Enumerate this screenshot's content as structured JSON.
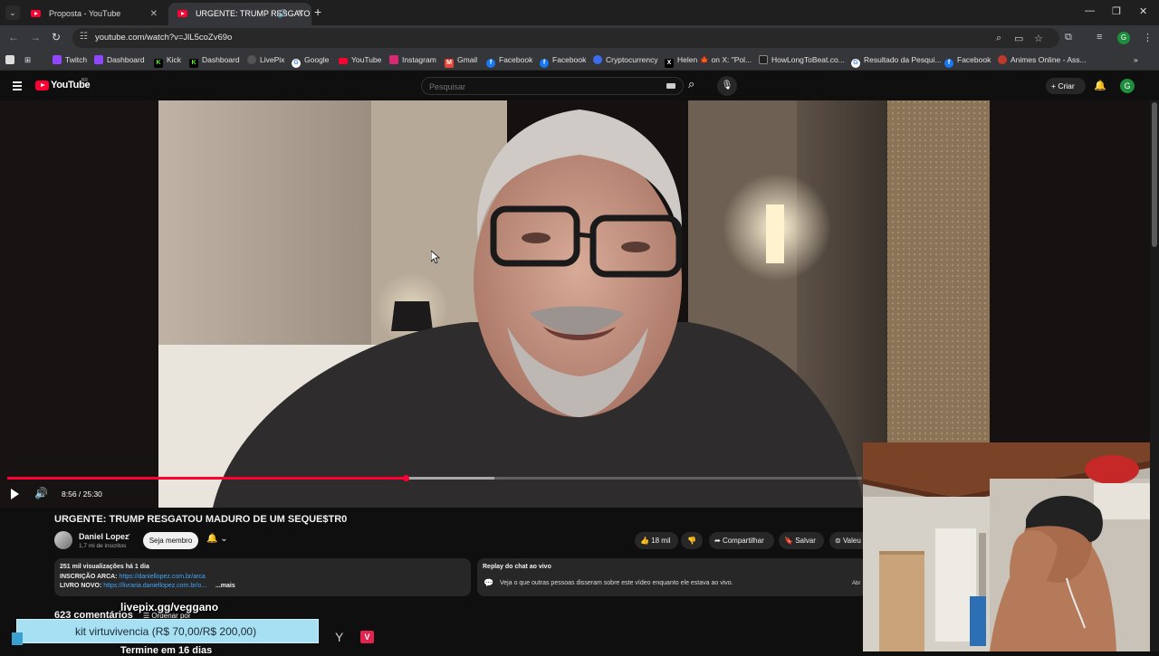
{
  "browser": {
    "tabs": [
      {
        "title": "Proposta - YouTube",
        "active": false
      },
      {
        "title": "URGENTE: TRUMP RESGATO",
        "active": true
      }
    ],
    "new_tab_label": "+",
    "url": "youtube.com/watch?v=JlL5coZv69o",
    "profile_initial": "G",
    "bookmarks": [
      {
        "label": "Twitch",
        "icon": "twitch-icon",
        "color": "#9146ff"
      },
      {
        "label": "Dashboard",
        "icon": "twitch-icon",
        "color": "#9146ff"
      },
      {
        "label": "Kick",
        "icon": "kick-icon",
        "color": "#53fc18"
      },
      {
        "label": "Dashboard",
        "icon": "kick-icon",
        "color": "#53fc18"
      },
      {
        "label": "LivePix",
        "icon": "livepix-icon",
        "color": "#8a8a8a"
      },
      {
        "label": "Google",
        "icon": "google-icon",
        "color": "#ffffff"
      },
      {
        "label": "YouTube",
        "icon": "youtube-icon",
        "color": "#ff0033"
      },
      {
        "label": "Instagram",
        "icon": "instagram-icon",
        "color": "#d62976"
      },
      {
        "label": "Gmail",
        "icon": "gmail-icon",
        "color": "#ea4335"
      },
      {
        "label": "Facebook",
        "icon": "facebook-icon",
        "color": "#1877f2"
      },
      {
        "label": "Facebook",
        "icon": "facebook-icon",
        "color": "#1877f2"
      },
      {
        "label": "Cryptocurrency",
        "icon": "crypto-icon",
        "color": "#3c6cf0"
      },
      {
        "label": "Helen 🍁 on X: \"Pol...",
        "icon": "x-icon",
        "color": "#000000"
      },
      {
        "label": "HowLongToBeat.co...",
        "icon": "hltb-icon",
        "color": "#222222"
      },
      {
        "label": "Resultado da Pesqui...",
        "icon": "google-icon",
        "color": "#ffffff"
      },
      {
        "label": "Facebook",
        "icon": "facebook-icon",
        "color": "#1877f2"
      },
      {
        "label": "Animes Online - Ass...",
        "icon": "anime-icon",
        "color": "#c0392b"
      }
    ]
  },
  "youtube": {
    "logo_text": "YouTube",
    "country_code": "BR",
    "search_placeholder": "Pesquisar",
    "create_label": "Criar",
    "avatar_initial": "G"
  },
  "player": {
    "current_time": "8:56",
    "duration": "25:30",
    "time_display": "8:56 / 25:30",
    "played_fraction": 0.466,
    "buffered_fraction": 0.57
  },
  "video": {
    "title": "URGENTE: TRUMP RESGATOU MADURO DE UM SEQUE$TR0",
    "channel": "Daniel Lopez",
    "subscribers": "1,7 mi de inscritos",
    "join_label": "Seja membro",
    "likes": "18 mil",
    "share_label": "Compartilhar",
    "save_label": "Salvar",
    "thanks_label": "Valeu",
    "description": {
      "stats": "251 mil visualizações  há 1 dia",
      "line1_label": "INSCRIÇÃO ARCA:",
      "line1_link": "https://daniellopez.com.br/arca",
      "line2_label": "LIVRO NOVO:",
      "line2_link": "https://livraria.daniellopez.com.br/o...",
      "more": "...mais"
    },
    "live_chat": {
      "title": "Replay do chat ao vivo",
      "subtitle": "Veja o que outras pessoas disseram sobre este vídeo enquanto ele estava ao vivo.",
      "open_label": "Abr"
    },
    "comments_count": "623 comentários",
    "sort_label": "Ordenar por"
  },
  "overlay": {
    "livepix_text": "livepix.gg/veggano",
    "kit_text": "kit virtuvivencia (R$ 70,00/R$ 200,00)",
    "bottom_text": "Termine em 16 dias"
  }
}
